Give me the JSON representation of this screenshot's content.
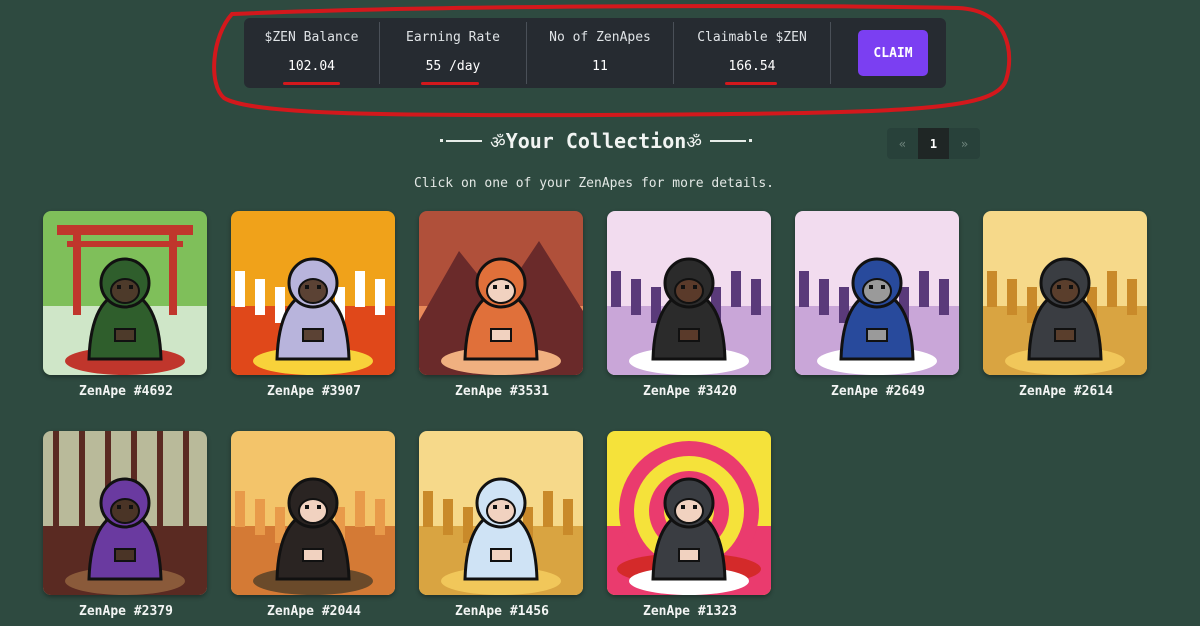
{
  "stats": {
    "balance_label": "$ZEN Balance",
    "balance_value": "102.04",
    "rate_label": "Earning Rate",
    "rate_value": "55 /day",
    "count_label": "No of ZenApes",
    "count_value": "11",
    "claimable_label": "Claimable $ZEN",
    "claimable_value": "166.54",
    "claim_button": "CLAIM"
  },
  "collection": {
    "title": "Your Collection",
    "symbol": "ॐ",
    "subtitle": "Click on one of your ZenApes for more details."
  },
  "pagination": {
    "prev": "«",
    "current": "1",
    "next": "»"
  },
  "colors": {
    "background": "#2e4a40",
    "panel": "#262b31",
    "accent": "#7b3ff2",
    "annotation": "#d3181c"
  },
  "apes": [
    {
      "name": "ZenApe #4692",
      "bg": "torii-gate",
      "skin": "#4d3a2a",
      "robe": "#2f5e2c"
    },
    {
      "name": "ZenApe #3907",
      "bg": "flames-skulls",
      "skin": "#5b4234",
      "robe": "#b8b4dc"
    },
    {
      "name": "ZenApe #3531",
      "bg": "mountain-sunset",
      "skin": "#f1d2c0",
      "robe": "#e0703a"
    },
    {
      "name": "ZenApe #3420",
      "bg": "snow-forest",
      "skin": "#5a3a2a",
      "robe": "#2b2b2b"
    },
    {
      "name": "ZenApe #2649",
      "bg": "snow-forest",
      "skin": "#9a9a9a",
      "robe": "#284a9c"
    },
    {
      "name": "ZenApe #2614",
      "bg": "wheat-field",
      "skin": "#5a3e2c",
      "robe": "#3a3d42"
    },
    {
      "name": "ZenApe #2379",
      "bg": "temple-room",
      "skin": "#4a3426",
      "robe": "#6a3aa0"
    },
    {
      "name": "ZenApe #2044",
      "bg": "desert",
      "skin": "#f1d2c0",
      "robe": "#2a2422"
    },
    {
      "name": "ZenApe #1456",
      "bg": "wheat-field",
      "skin": "#f1d2c0",
      "robe": "#cfe3f5"
    },
    {
      "name": "ZenApe #1323",
      "bg": "mushroom-swirl",
      "skin": "#f1d2c0",
      "robe": "#3a3d42"
    }
  ]
}
